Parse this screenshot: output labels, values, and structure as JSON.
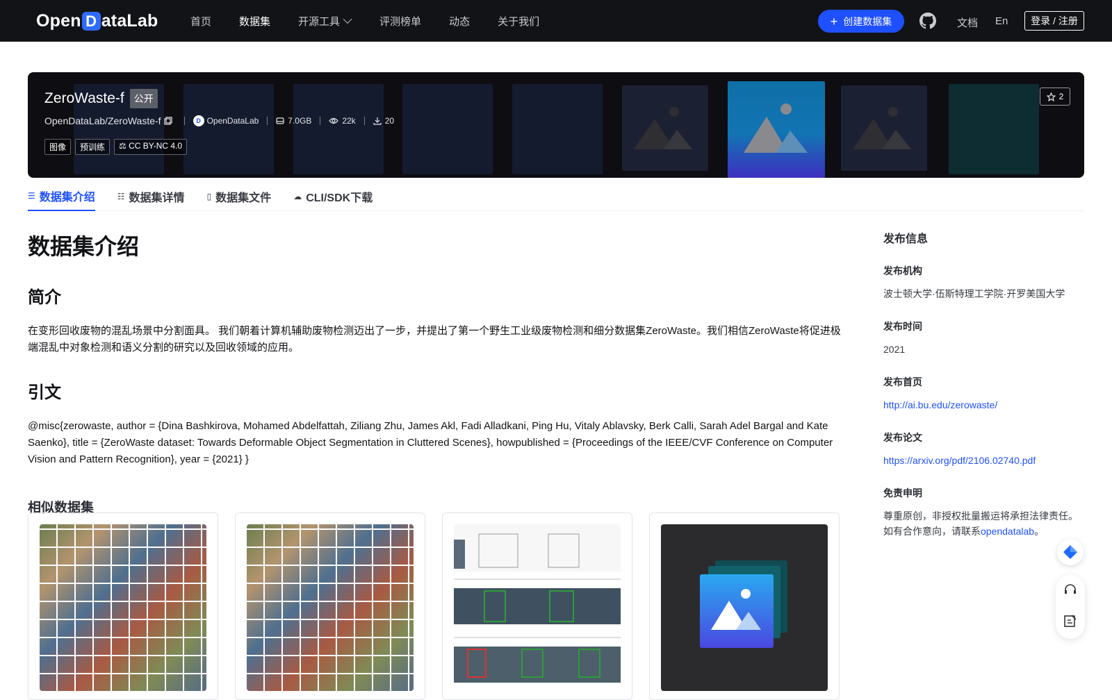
{
  "header": {
    "logo_text_a": "Open",
    "logo_text_b": "D",
    "logo_text_c": "ataLab",
    "nav": [
      {
        "label": "首页"
      },
      {
        "label": "数据集"
      },
      {
        "label": "开源工具"
      },
      {
        "label": "评测榜单"
      },
      {
        "label": "动态"
      },
      {
        "label": "关于我们"
      }
    ],
    "create_label": "创建数据集",
    "docs_label": "文档",
    "lang_label": "En",
    "login_label": "登录 / 注册"
  },
  "banner": {
    "name": "ZeroWaste-f",
    "visibility": "公开",
    "path": "OpenDataLab/ZeroWaste-f",
    "org": "OpenDataLab",
    "size": "7.0GB",
    "views": "22k",
    "downloads": "20",
    "tags": [
      "图像",
      "预训练"
    ],
    "license": "CC BY-NC 4.0",
    "stars": "2"
  },
  "tabs": [
    {
      "label": "数据集介绍",
      "active": true
    },
    {
      "label": "数据集详情"
    },
    {
      "label": "数据集文件"
    },
    {
      "label": "CLI/SDK下载"
    }
  ],
  "main": {
    "title": "数据集介绍",
    "intro_heading": "简介",
    "intro_text": "在变形回收废物的混乱场景中分割面具。 我们朝着计算机辅助废物检测迈出了一步，并提出了第一个野生工业级废物检测和细分数据集ZeroWaste。我们相信ZeroWaste将促进极端混乱中对象检测和语义分割的研究以及回收领域的应用。",
    "cite_heading": "引文",
    "cite_text": "@misc{zerowaste, author = {Dina Bashkirova, Mohamed Abdelfattah, Ziliang Zhu, James Akl, Fadi Alladkani, Ping Hu, Vitaly Ablavsky, Berk Calli, Sarah Adel Bargal and Kate Saenko}, title = {ZeroWaste dataset: Towards Deformable Object Segmentation in Cluttered Scenes}, howpublished = {Proceedings of the IEEE/CVF Conference on Computer Vision and Pattern Recognition}, year = {2021} }",
    "similar_heading": "相似数据集"
  },
  "sidebar": {
    "heading": "发布信息",
    "org_label": "发布机构",
    "org_value": "波士顿大学·伍斯特理工学院·开罗美国大学",
    "time_label": "发布时间",
    "time_value": "2021",
    "home_label": "发布首页",
    "home_value": "http://ai.bu.edu/zerowaste/",
    "paper_label": "发布论文",
    "paper_value": "https://arxiv.org/pdf/2106.02740.pdf",
    "disclaimer_label": "免责申明",
    "disclaimer_a": "尊重原创，非授权批量搬运将承担法律责任。如有合作意向，请联系",
    "disclaimer_link": "opendatalab",
    "disclaimer_end": "。"
  },
  "colors": {
    "accent": "#1f50ff",
    "topbar": "#121316"
  }
}
